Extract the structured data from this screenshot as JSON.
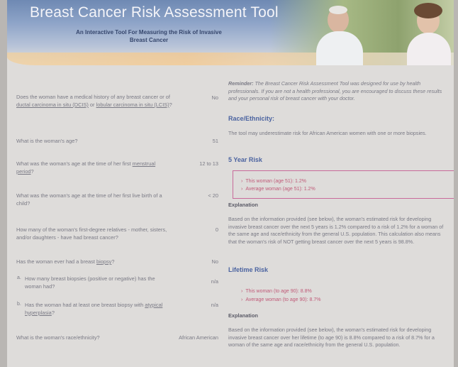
{
  "banner": {
    "title": "Breast Cancer Risk Assessment Tool",
    "subtitle": "An Interactive Tool For Measuring the Risk of Invasive Breast Cancer"
  },
  "questions": [
    {
      "text": "Does the woman have a medical history of any breast cancer or of ductal carcinoma in situ (DCIS) or lobular carcinoma in situ (LCIS)?",
      "answer": "No"
    },
    {
      "text": "What is the woman's age?",
      "answer": "51"
    },
    {
      "text": "What was the woman's age at the time of her first menstrual period?",
      "answer": "12 to 13"
    },
    {
      "text": "What was the woman's age at the time of her first live birth of a child?",
      "answer": "< 20"
    },
    {
      "text": "How many of the woman's first-degree relatives - mother, sisters, and/or daughters - have had breast cancer?",
      "answer": "0"
    },
    {
      "text": "Has the woman ever had a breast biopsy?",
      "answer": "No"
    },
    {
      "text": "How many breast biopsies (positive or negative) has the woman had?",
      "answer": "n/a",
      "bullet": "a."
    },
    {
      "text": "Has the woman had at least one breast biopsy with atypical hyperplasia?",
      "answer": "n/a",
      "bullet": "b."
    },
    {
      "text": "What is the woman's race/ethnicity?",
      "answer": "African American"
    }
  ],
  "reminder": {
    "label": "Reminder:",
    "text": "The Breast Cancer Risk Assessment Tool was designed for use by health professionals. If you are not a health professional, you are encouraged to discuss these results and your personal risk of breast cancer with your doctor."
  },
  "race_section": {
    "heading": "Race/Ethnicity:",
    "text": "The tool may underestimate risk for African American women with one or more biopsies."
  },
  "five_year": {
    "heading": "5 Year Risk",
    "this_woman": "This woman (age 51): 1.2%",
    "average_woman": "Average woman (age 51): 1.2%",
    "explanation_label": "Explanation",
    "explanation": "Based on the information provided (see below), the woman's estimated risk for developing invasive breast cancer over the next 5 years is 1.2% compared to a risk of 1.2% for a woman of the same age and race/ethnicity from the general U.S. population. This calculation also means that the woman's risk of NOT getting breast cancer over the next 5 years is 98.8%."
  },
  "lifetime": {
    "heading": "Lifetime Risk",
    "this_woman": "This woman (to age 90): 8.8%",
    "average_woman": "Average woman (to age 90): 8.7%",
    "explanation_label": "Explanation",
    "explanation": "Based on the information provided (see below), the woman's estimated risk for developing invasive breast cancer over her lifetime (to age 90) is 8.8% compared to a risk of 8.7% for a woman of the same age and race/ethnicity from the general U.S. population."
  }
}
